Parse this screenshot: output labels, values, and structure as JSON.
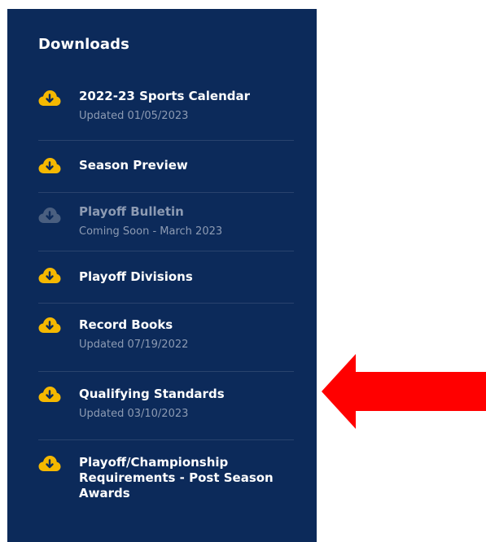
{
  "panel": {
    "title": "Downloads",
    "items": [
      {
        "label": "2022-23 Sports Calendar",
        "sub": "Updated 01/05/2023",
        "icon": "cloud-download-icon",
        "enabled": true
      },
      {
        "label": "Season Preview",
        "sub": "",
        "icon": "cloud-download-icon",
        "enabled": true
      },
      {
        "label": "Playoff Bulletin",
        "sub": "Coming Soon - March 2023",
        "icon": "cloud-download-icon",
        "enabled": false
      },
      {
        "label": "Playoff Divisions",
        "sub": "",
        "icon": "cloud-download-icon",
        "enabled": true
      },
      {
        "label": "Record Books",
        "sub": "Updated 07/19/2022",
        "icon": "cloud-download-icon",
        "enabled": true
      },
      {
        "label": "Qualifying Standards",
        "sub": "Updated 03/10/2023",
        "icon": "cloud-download-icon",
        "enabled": true
      },
      {
        "label": "Playoff/Championship Requirements - Post Season Awards",
        "sub": "",
        "icon": "cloud-download-icon",
        "enabled": true
      }
    ]
  },
  "annotation": {
    "icon": "left-arrow-icon",
    "color": "#ff0000"
  },
  "colors": {
    "panel_bg": "#0c2a5a",
    "icon_active": "#f5b800",
    "icon_disabled": "#4a5f80",
    "text_primary": "#ffffff",
    "text_muted": "#8d9bb3"
  }
}
